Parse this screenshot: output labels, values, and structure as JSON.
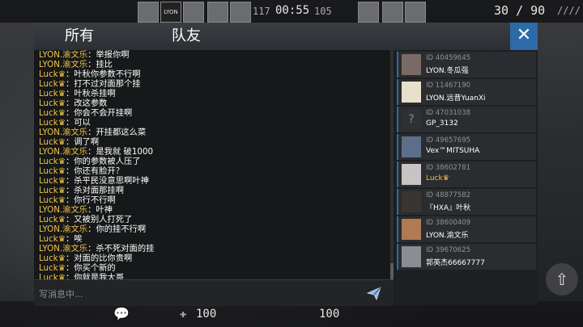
{
  "hud": {
    "score_left": "117",
    "timer": "00:55",
    "score_right": "105",
    "ammo": "30 / 90",
    "ammo_bars": "////",
    "health_left": "100",
    "health_right": "100",
    "tile_label": "LYON"
  },
  "tabs": [
    {
      "label": "所有"
    },
    {
      "label": "队友"
    }
  ],
  "close_label": "✕",
  "chat": {
    "messages": [
      {
        "name": "LYON.渝文乐",
        "text": "举报你啊"
      },
      {
        "name": "LYON.渝文乐",
        "text": "挂比"
      },
      {
        "name": "Luck♛",
        "text": "叶秋你参数不行啊"
      },
      {
        "name": "Luck♛",
        "text": "打不过对面那个挂"
      },
      {
        "name": "Luck♛",
        "text": "叶秋杀挂啊"
      },
      {
        "name": "Luck♛",
        "text": "改这参数"
      },
      {
        "name": "Luck♛",
        "text": "你会不会开挂啊"
      },
      {
        "name": "Luck♛",
        "text": "可以"
      },
      {
        "name": "LYON.渝文乐",
        "text": "开挂都这么菜"
      },
      {
        "name": "Luck♛",
        "text": "调了啊"
      },
      {
        "name": "LYON.渝文乐",
        "text": "是我就 破1000"
      },
      {
        "name": "Luck♛",
        "text": "你的参数被人压了"
      },
      {
        "name": "Luck♛",
        "text": "你还有脸开？"
      },
      {
        "name": "Luck♛",
        "text": "杀平民没意思啊叶神"
      },
      {
        "name": "Luck♛",
        "text": "杀对面那挂啊"
      },
      {
        "name": "Luck♛",
        "text": "你行不行啊"
      },
      {
        "name": "LYON.渝文乐",
        "text": "叶神"
      },
      {
        "name": "Luck♛",
        "text": "又被别人打死了"
      },
      {
        "name": "LYON.渝文乐",
        "text": "你的挂不行啊"
      },
      {
        "name": "Luck♛",
        "text": "唉"
      },
      {
        "name": "LYON.渝文乐",
        "text": "杀不死对面的挂"
      },
      {
        "name": "Luck♛",
        "text": "对面的比你贵啊"
      },
      {
        "name": "Luck♛",
        "text": "你买个新的"
      },
      {
        "name": "Luck♛",
        "text": "你就是我大哥"
      }
    ],
    "separator": "：",
    "input_placeholder": "写消息中..."
  },
  "players": [
    {
      "id": "ID 40459645",
      "name": "LYON.冬瓜强"
    },
    {
      "id": "ID 11467190",
      "name": "LYON.远昔YuanXi"
    },
    {
      "id": "ID 47031038",
      "name": "GP_3132"
    },
    {
      "id": "ID 49657695",
      "name": "Vex™MITSUHA"
    },
    {
      "id": "ID 38602781",
      "name": "Luck♛"
    },
    {
      "id": "ID 48877582",
      "name": "『HXA』叶秋"
    },
    {
      "id": "ID 38600409",
      "name": "LYON.渝文乐"
    },
    {
      "id": "ID 39670625",
      "name": "郭英杰66667777"
    }
  ],
  "colors": {
    "accent": "#2d6aa8",
    "name_gold": "#f1c24a"
  }
}
